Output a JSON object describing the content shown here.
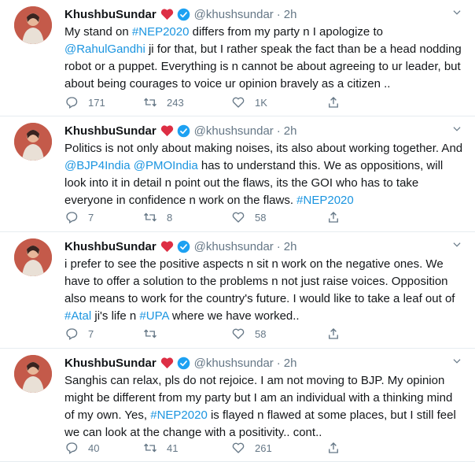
{
  "tweets": [
    {
      "name": "KhushbuSundar",
      "handle": "@khushsundar",
      "time": "2h",
      "body": [
        {
          "t": "My stand on "
        },
        {
          "t": "#NEP2020",
          "link": true
        },
        {
          "t": " differs from my party n I apologize to "
        },
        {
          "t": "@RahulGandhi",
          "link": true
        },
        {
          "t": " ji for that, but I rather speak the fact than be a head nodding robot or a puppet. Everything is n cannot be about agreeing to ur leader, but about being courages to voice ur opinion bravely as a citizen .."
        }
      ],
      "replies": "171",
      "retweets": "243",
      "likes": "1K"
    },
    {
      "name": "KhushbuSundar",
      "handle": "@khushsundar",
      "time": "2h",
      "body": [
        {
          "t": "Politics is not only about making noises, its also about working together. And "
        },
        {
          "t": "@BJP4India",
          "link": true
        },
        {
          "t": " "
        },
        {
          "t": "@PMOIndia",
          "link": true
        },
        {
          "t": " has to understand this. We as oppositions, will look into it in detail n point out the flaws, its the GOI who has to take everyone in confidence n work on the flaws. "
        },
        {
          "t": "#NEP2020",
          "link": true
        }
      ],
      "replies": "7",
      "retweets": "8",
      "likes": "58"
    },
    {
      "name": "KhushbuSundar",
      "handle": "@khushsundar",
      "time": "2h",
      "body": [
        {
          "t": "i prefer to see the positive aspects n sit n work on the negative ones. We have to offer a solution to the problems n not just raise voices. Opposition also means to work for the country's future. I would like to take  a leaf out of "
        },
        {
          "t": "#Atal",
          "link": true
        },
        {
          "t": " ji's life n "
        },
        {
          "t": "#UPA",
          "link": true
        },
        {
          "t": " where we have worked.."
        }
      ],
      "replies": "7",
      "retweets": "",
      "likes": "58"
    },
    {
      "name": "KhushbuSundar",
      "handle": "@khushsundar",
      "time": "2h",
      "body": [
        {
          "t": "Sanghis can relax, pls do not rejoice. I am not moving to BJP. My opinion might be different from my party but I am an individual with a thinking mind of my own. Yes, "
        },
        {
          "t": "#NEP2020",
          "link": true
        },
        {
          "t": " is flayed n flawed at some places, but I still feel we can look at the change with a positivity.. cont.."
        }
      ],
      "replies": "40",
      "retweets": "41",
      "likes": "261"
    }
  ],
  "colors": {
    "link": "#1b95e0",
    "muted": "#657786",
    "heart": "#e0245e",
    "verified": "#1da1f2"
  },
  "icons": [
    "reply-icon",
    "retweet-icon",
    "like-icon",
    "share-icon",
    "verified-icon",
    "heart-emoji-icon",
    "chevron-down-icon"
  ]
}
